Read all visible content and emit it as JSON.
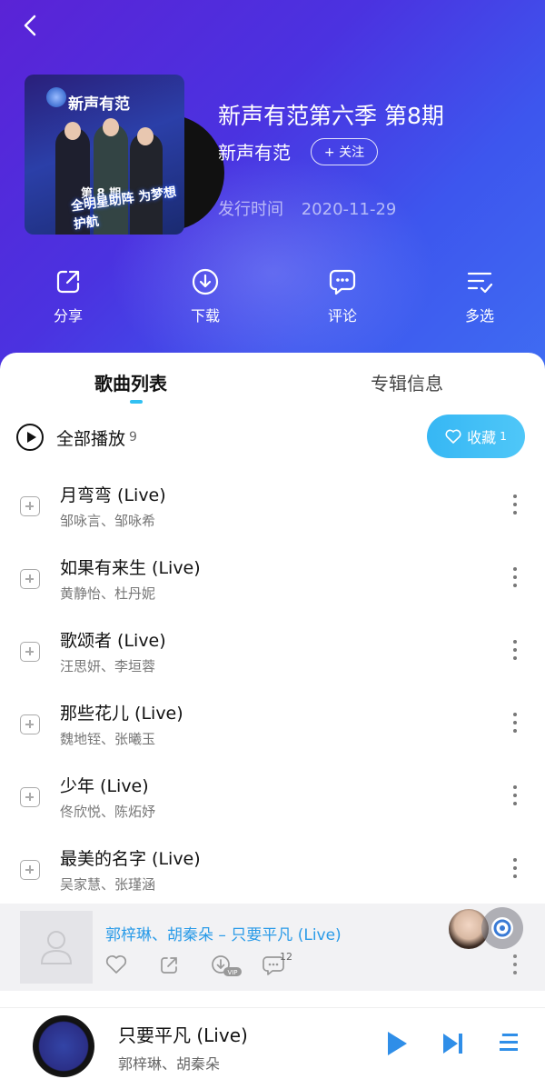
{
  "header": {
    "album_title": "新声有范第六季 第8期",
    "artist": "新声有范",
    "follow_label": "+ 关注",
    "release_label": "发行时间",
    "release_date": "2020-11-29",
    "cover_logo": "新声有范",
    "cover_episode": "第 8 期",
    "cover_slogan": "全明星助阵 为梦想护航"
  },
  "actions": [
    {
      "label": "分享",
      "icon": "share-icon"
    },
    {
      "label": "下载",
      "icon": "download-icon"
    },
    {
      "label": "评论",
      "icon": "comment-icon"
    },
    {
      "label": "多选",
      "icon": "multi-select-icon"
    }
  ],
  "tabs": [
    {
      "label": "歌曲列表",
      "active": true
    },
    {
      "label": "专辑信息",
      "active": false
    }
  ],
  "play_all": {
    "label": "全部播放",
    "count": "9"
  },
  "collect": {
    "label": "收藏",
    "count": "1"
  },
  "songs": [
    {
      "title": "月弯弯 (Live)",
      "singers": "邹咏言、邹咏希"
    },
    {
      "title": "如果有来生 (Live)",
      "singers": "黄静怡、杜丹妮"
    },
    {
      "title": "歌颂者 (Live)",
      "singers": "汪思妍、李垣蓉"
    },
    {
      "title": "那些花儿 (Live)",
      "singers": "魏地铚、张曦玉"
    },
    {
      "title": "少年 (Live)",
      "singers": "佟欣悦、陈炻妤"
    },
    {
      "title": "最美的名字 (Live)",
      "singers": "吴家慧、张瑾涵"
    }
  ],
  "mini_card": {
    "title": "郭梓琳、胡秦朵 – 只要平凡 (Live)",
    "comment_count": "12"
  },
  "player": {
    "title": "只要平凡 (Live)",
    "artist": "郭梓琳、胡秦朵"
  },
  "colors": {
    "accent": "#31c0f2",
    "header_start": "#5a23d6",
    "header_end": "#3f6cf2",
    "mini_title": "#2a9be8"
  }
}
